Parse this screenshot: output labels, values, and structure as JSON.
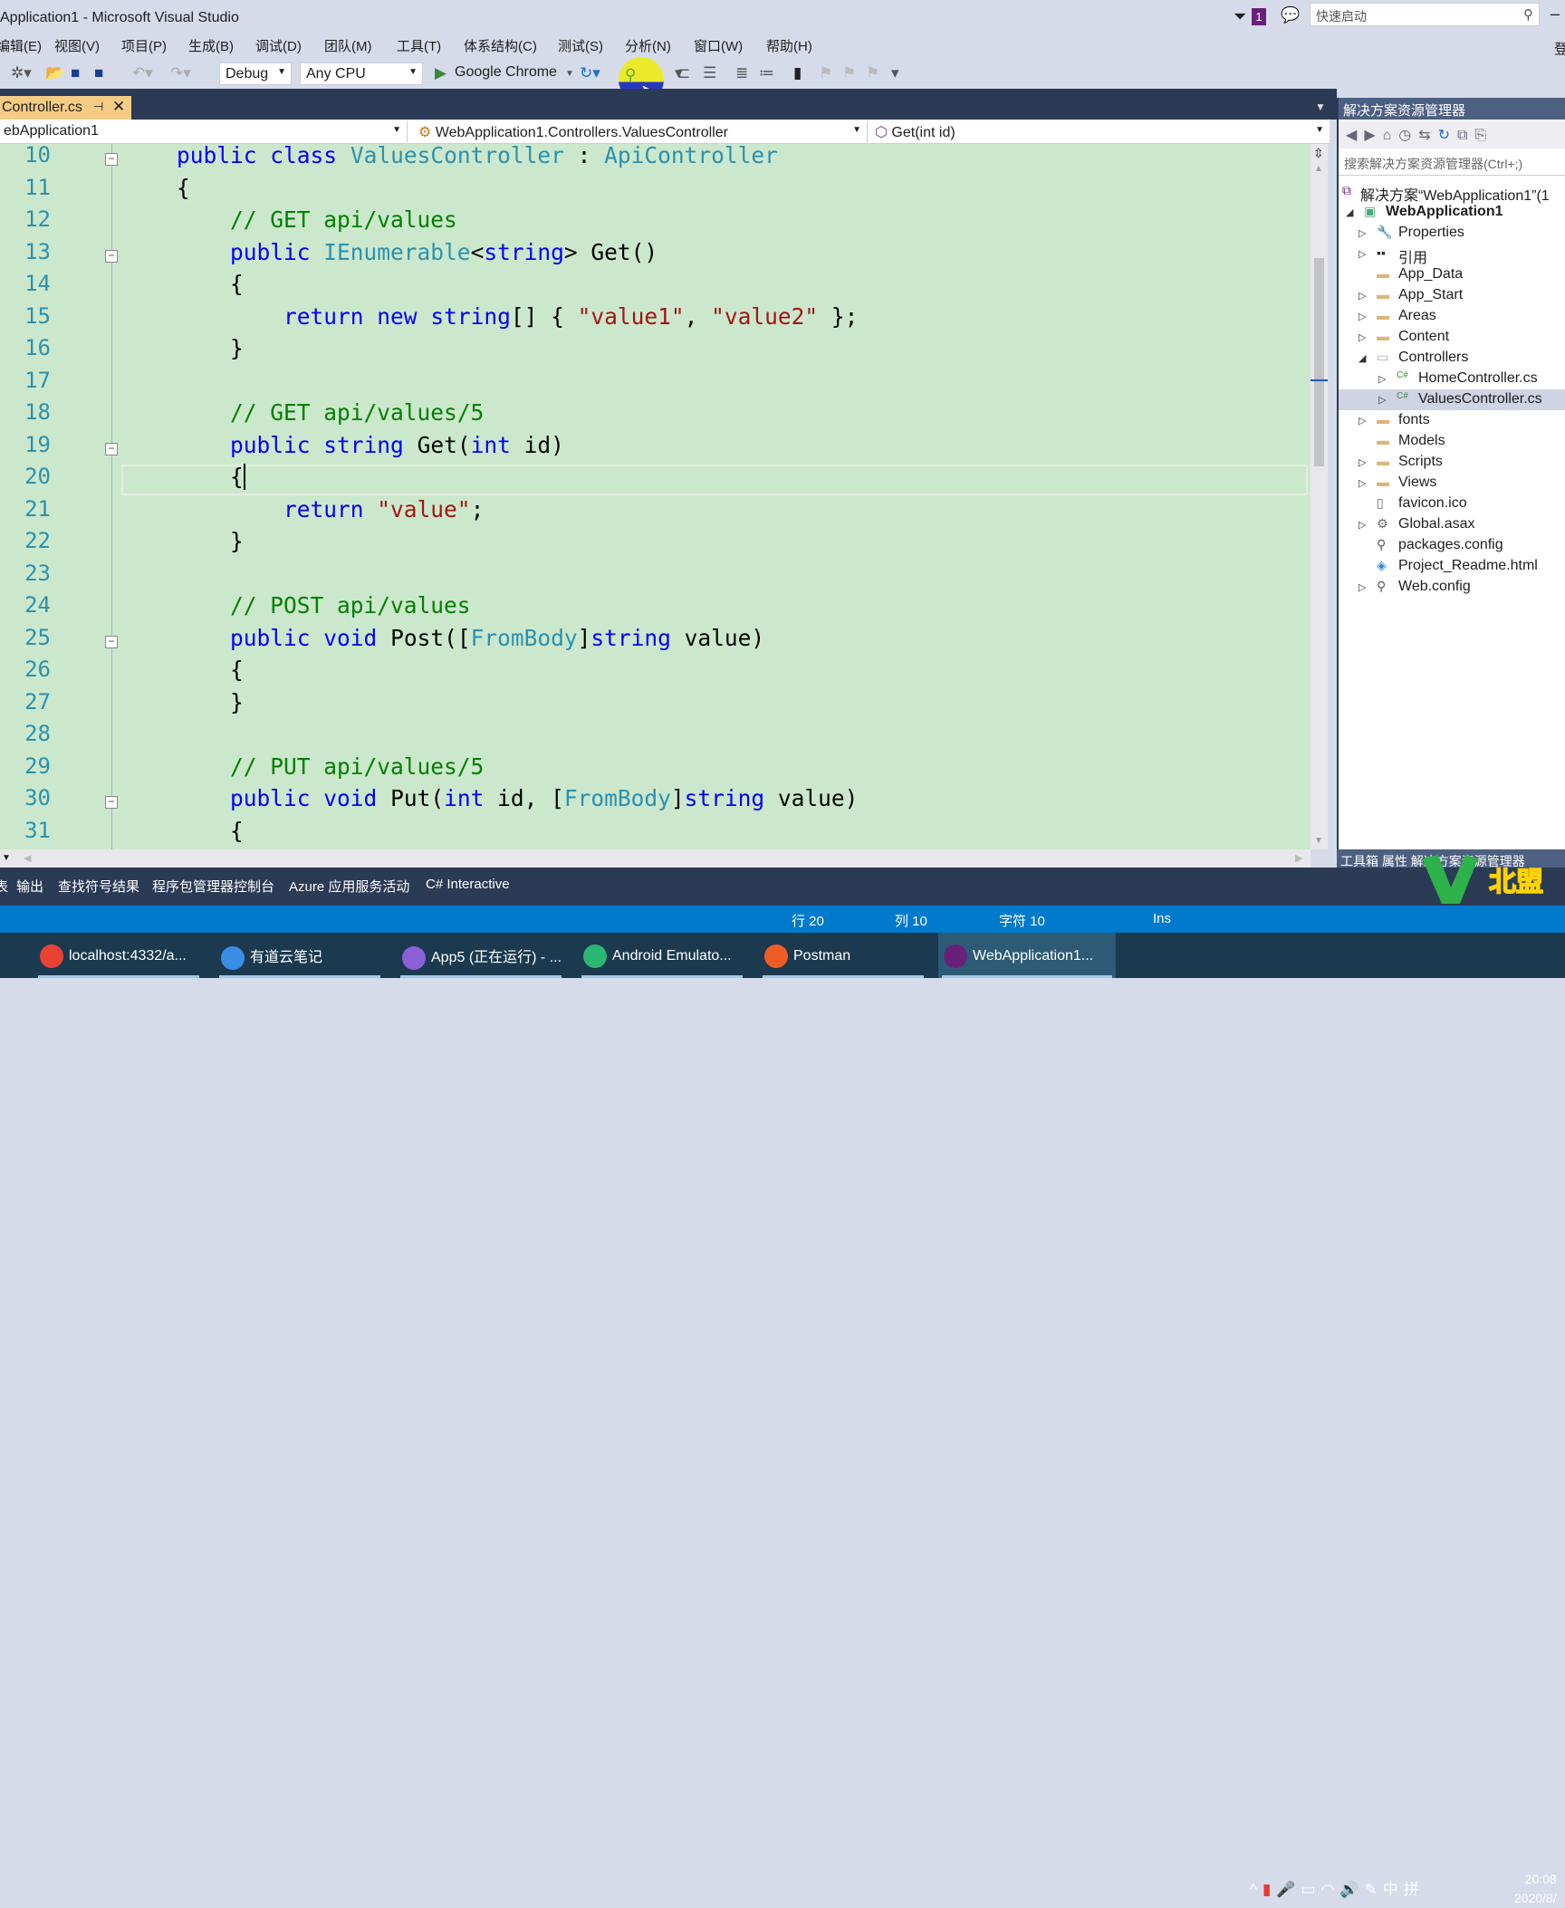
{
  "window": {
    "title": "Application1 - Microsoft Visual Studio",
    "notification_count": "1",
    "quick_launch_placeholder": "快速启动",
    "login": "登"
  },
  "menu": [
    "编辑(E)",
    "视图(V)",
    "项目(P)",
    "生成(B)",
    "调试(D)",
    "团队(M)",
    "工具(T)",
    "体系结构(C)",
    "测试(S)",
    "分析(N)",
    "窗口(W)",
    "帮助(H)"
  ],
  "toolbar": {
    "config": "Debug",
    "platform": "Any CPU",
    "run_target": "Google Chrome"
  },
  "tab": {
    "label": "Controller.cs"
  },
  "nav": {
    "project": "ebApplication1",
    "class": "WebApplication1.Controllers.ValuesController",
    "member": "Get(int id)"
  },
  "colors": {
    "editor_bg": "#cce8cc",
    "keyword": "#0000ff",
    "type": "#2b91af",
    "comment": "#008000",
    "string": "#a31515",
    "accent": "#007acc"
  },
  "code": [
    {
      "n": "10",
      "fold": true,
      "t": [
        [
          "    ",
          ""
        ],
        [
          "public",
          "kw"
        ],
        [
          " ",
          ""
        ],
        [
          "class",
          "kw"
        ],
        [
          " ",
          ""
        ],
        [
          "ValuesController",
          "ty"
        ],
        [
          " : ",
          ""
        ],
        [
          "ApiController",
          "ty"
        ]
      ]
    },
    {
      "n": "11",
      "t": [
        [
          "    {",
          ""
        ]
      ]
    },
    {
      "n": "12",
      "t": [
        [
          "        ",
          ""
        ],
        [
          "// GET api/values",
          "cm"
        ]
      ]
    },
    {
      "n": "13",
      "fold": true,
      "t": [
        [
          "        ",
          ""
        ],
        [
          "public",
          "kw"
        ],
        [
          " ",
          ""
        ],
        [
          "IEnumerable",
          "ty"
        ],
        [
          "<",
          ""
        ],
        [
          "string",
          "kw"
        ],
        [
          "> Get()",
          ""
        ]
      ]
    },
    {
      "n": "14",
      "t": [
        [
          "        {",
          ""
        ]
      ]
    },
    {
      "n": "15",
      "t": [
        [
          "            ",
          ""
        ],
        [
          "return",
          "kw"
        ],
        [
          " ",
          ""
        ],
        [
          "new",
          "kw"
        ],
        [
          " ",
          ""
        ],
        [
          "string",
          "kw"
        ],
        [
          "[] { ",
          ""
        ],
        [
          "\"value1\"",
          "st"
        ],
        [
          ", ",
          ""
        ],
        [
          "\"value2\"",
          "st"
        ],
        [
          " };",
          ""
        ]
      ]
    },
    {
      "n": "16",
      "t": [
        [
          "        }",
          ""
        ]
      ]
    },
    {
      "n": "17",
      "t": []
    },
    {
      "n": "18",
      "t": [
        [
          "        ",
          ""
        ],
        [
          "// GET api/values/5",
          "cm"
        ]
      ]
    },
    {
      "n": "19",
      "fold": true,
      "t": [
        [
          "        ",
          ""
        ],
        [
          "public",
          "kw"
        ],
        [
          " ",
          ""
        ],
        [
          "string",
          "kw"
        ],
        [
          " Get(",
          ""
        ],
        [
          "int",
          "kw"
        ],
        [
          " id)",
          ""
        ]
      ]
    },
    {
      "n": "20",
      "current": true,
      "t": [
        [
          "        {",
          ""
        ]
      ]
    },
    {
      "n": "21",
      "t": [
        [
          "            ",
          ""
        ],
        [
          "return",
          "kw"
        ],
        [
          " ",
          ""
        ],
        [
          "\"value\"",
          "st"
        ],
        [
          ";",
          ""
        ]
      ]
    },
    {
      "n": "22",
      "t": [
        [
          "        }",
          ""
        ]
      ]
    },
    {
      "n": "23",
      "t": []
    },
    {
      "n": "24",
      "t": [
        [
          "        ",
          ""
        ],
        [
          "// POST api/values",
          "cm"
        ]
      ]
    },
    {
      "n": "25",
      "fold": true,
      "t": [
        [
          "        ",
          ""
        ],
        [
          "public",
          "kw"
        ],
        [
          " ",
          ""
        ],
        [
          "void",
          "kw"
        ],
        [
          " Post([",
          ""
        ],
        [
          "FromBody",
          "ty"
        ],
        [
          "]",
          ""
        ],
        [
          "string",
          "kw"
        ],
        [
          " value)",
          ""
        ]
      ]
    },
    {
      "n": "26",
      "t": [
        [
          "        {",
          ""
        ]
      ]
    },
    {
      "n": "27",
      "t": [
        [
          "        }",
          ""
        ]
      ]
    },
    {
      "n": "28",
      "t": []
    },
    {
      "n": "29",
      "t": [
        [
          "        ",
          ""
        ],
        [
          "// PUT api/values/5",
          "cm"
        ]
      ]
    },
    {
      "n": "30",
      "fold": true,
      "t": [
        [
          "        ",
          ""
        ],
        [
          "public",
          "kw"
        ],
        [
          " ",
          ""
        ],
        [
          "void",
          "kw"
        ],
        [
          " Put(",
          ""
        ],
        [
          "int",
          "kw"
        ],
        [
          " id, [",
          ""
        ],
        [
          "FromBody",
          "ty"
        ],
        [
          "]",
          ""
        ],
        [
          "string",
          "kw"
        ],
        [
          " value)",
          ""
        ]
      ]
    },
    {
      "n": "31",
      "t": [
        [
          "        {",
          ""
        ]
      ]
    }
  ],
  "solution_explorer": {
    "title": "解决方案资源管理器",
    "search_placeholder": "搜索解决方案资源管理器(Ctrl+;)",
    "items": [
      {
        "label": "解决方案“WebApplication1”(1",
        "level": 0,
        "icon": "solution-icon",
        "arrow": ""
      },
      {
        "label": "WebApplication1",
        "level": 0,
        "icon": "web-project-icon",
        "arrow": "expanded",
        "bold": true
      },
      {
        "label": "Properties",
        "level": 1,
        "icon": "wrench-icon",
        "arrow": "collapsed"
      },
      {
        "label": "引用",
        "level": 1,
        "icon": "references-icon",
        "arrow": "collapsed"
      },
      {
        "label": "App_Data",
        "level": 1,
        "icon": "folder-icon",
        "arrow": ""
      },
      {
        "label": "App_Start",
        "level": 1,
        "icon": "folder-icon",
        "arrow": "collapsed"
      },
      {
        "label": "Areas",
        "level": 1,
        "icon": "folder-icon",
        "arrow": "collapsed"
      },
      {
        "label": "Content",
        "level": 1,
        "icon": "folder-icon",
        "arrow": "collapsed"
      },
      {
        "label": "Controllers",
        "level": 1,
        "icon": "folder-open-icon",
        "arrow": "expanded"
      },
      {
        "label": "HomeController.cs",
        "level": 2,
        "icon": "csharp-file-icon",
        "arrow": "collapsed"
      },
      {
        "label": "ValuesController.cs",
        "level": 2,
        "icon": "csharp-file-icon",
        "arrow": "collapsed",
        "selected": true
      },
      {
        "label": "fonts",
        "level": 1,
        "icon": "folder-icon",
        "arrow": "collapsed"
      },
      {
        "label": "Models",
        "level": 1,
        "icon": "folder-icon",
        "arrow": ""
      },
      {
        "label": "Scripts",
        "level": 1,
        "icon": "folder-icon",
        "arrow": "collapsed"
      },
      {
        "label": "Views",
        "level": 1,
        "icon": "folder-icon",
        "arrow": "collapsed"
      },
      {
        "label": "favicon.ico",
        "level": 1,
        "icon": "file-icon",
        "arrow": ""
      },
      {
        "label": "Global.asax",
        "level": 1,
        "icon": "gear-file-icon",
        "arrow": "collapsed"
      },
      {
        "label": "packages.config",
        "level": 1,
        "icon": "config-file-icon",
        "arrow": ""
      },
      {
        "label": "Project_Readme.html",
        "level": 1,
        "icon": "html-file-icon",
        "arrow": ""
      },
      {
        "label": "Web.config",
        "level": 1,
        "icon": "config-file-icon",
        "arrow": "collapsed"
      }
    ],
    "bottom_tabs": [
      "工具箱",
      "属性",
      "解决方案资源管理器"
    ]
  },
  "bottom_tabs": [
    "表",
    "输出",
    "查找符号结果",
    "程序包管理器控制台",
    "Azure 应用服务活动",
    "C# Interactive"
  ],
  "status": {
    "line": "行 20",
    "col": "列 10",
    "char": "字符 10",
    "mode": "Ins"
  },
  "taskbar": {
    "items": [
      {
        "label": "localhost:4332/a...",
        "color": "#e94235"
      },
      {
        "label": "有道云笔记",
        "color": "#3a8ee6"
      },
      {
        "label": "App5 (正在运行) - ...",
        "color": "#8b5fd6"
      },
      {
        "label": "Android Emulato...",
        "color": "#2bb673"
      },
      {
        "label": "Postman",
        "color": "#ef5b25"
      },
      {
        "label": "WebApplication1...",
        "color": "#68217a",
        "active": true
      }
    ],
    "ime": "中",
    "time": "20:08",
    "date": "2020/8/"
  },
  "watermark": "北盟"
}
